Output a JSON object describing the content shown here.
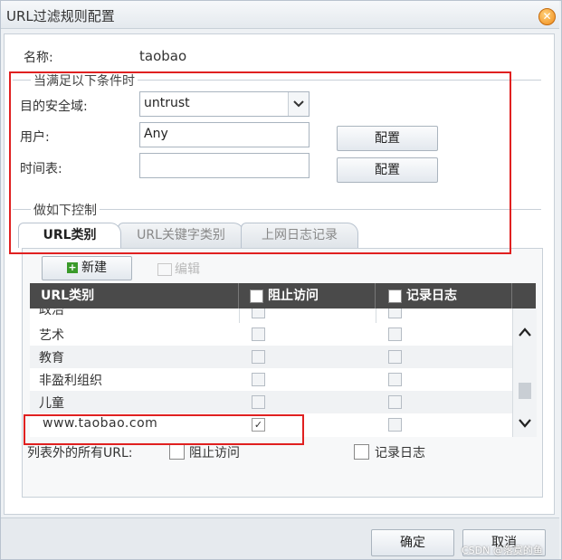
{
  "window": {
    "title": "URL过滤规则配置"
  },
  "name_row": {
    "label": "名称:",
    "value": "taobao"
  },
  "conditions": {
    "legend": "当满足以下条件时",
    "zone_label": "目的安全域:",
    "zone_value": "untrust",
    "user_label": "用户:",
    "user_value": "Any",
    "user_config_button": "配置",
    "schedule_label": "时间表:",
    "schedule_value": "",
    "schedule_config_button": "配置"
  },
  "controls": {
    "legend": "做如下控制"
  },
  "tabs": [
    {
      "label": "URL类别",
      "active": true
    },
    {
      "label": "URL关键字类别",
      "active": false
    },
    {
      "label": "上网日志记录",
      "active": false
    }
  ],
  "toolbar": {
    "new_label": "新建",
    "edit_label": "编辑"
  },
  "table": {
    "headers": [
      "URL类别",
      "阻止访问",
      "记录日志"
    ],
    "rows": [
      {
        "category": "政治",
        "block": false,
        "log": false
      },
      {
        "category": "艺术",
        "block": false,
        "log": false
      },
      {
        "category": "教育",
        "block": false,
        "log": false
      },
      {
        "category": "非盈利组织",
        "block": false,
        "log": false
      },
      {
        "category": "儿童",
        "block": false,
        "log": false
      },
      {
        "category": "www.taobao.com",
        "block": true,
        "log": false
      }
    ]
  },
  "default_row": {
    "label": "列表外的所有URL:",
    "block_label": "阻止访问",
    "log_label": "记录日志"
  },
  "footer": {
    "ok_label": "确定",
    "cancel_label": "取消"
  },
  "watermark": "CSDN @落寞的鱼"
}
